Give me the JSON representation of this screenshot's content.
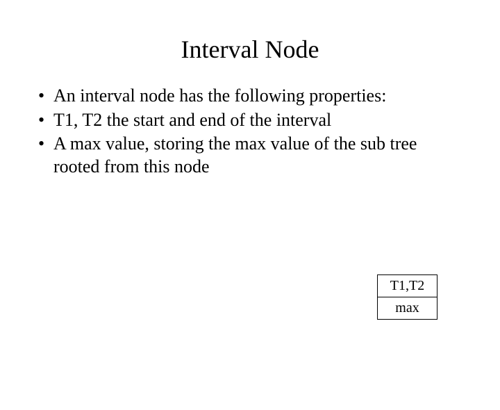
{
  "title": "Interval Node",
  "bullets": [
    "An interval node has the following properties:",
    "T1, T2 the start and end of the interval",
    "A max value, storing the max value of the sub tree rooted from this node"
  ],
  "node": {
    "top": "T1,T2",
    "bottom": "max"
  }
}
